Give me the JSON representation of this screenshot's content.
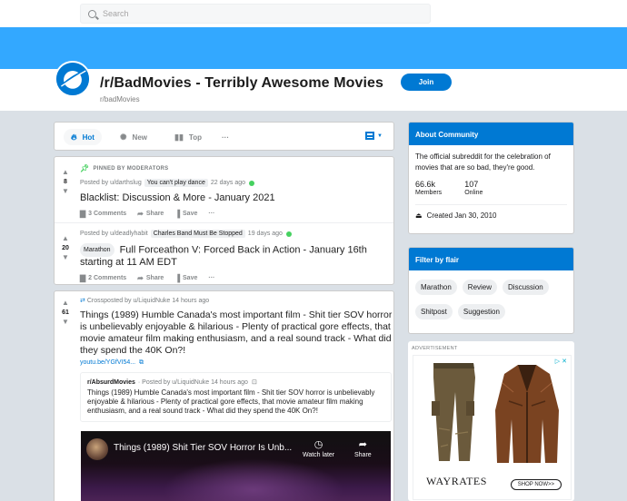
{
  "search": {
    "placeholder": "Search"
  },
  "colors": {
    "banner": "#33a8ff",
    "brand": "#0079d3",
    "mod_pin": "#46d160"
  },
  "subreddit": {
    "title": "/r/BadMovies - Terribly Awesome Movies",
    "name": "r/badMovies",
    "join_label": "Join",
    "logo_icon": "planet-icon"
  },
  "sort": {
    "items": [
      {
        "label": "Hot",
        "icon": "flame-icon"
      },
      {
        "label": "New",
        "icon": "sparkle-icon"
      },
      {
        "label": "Top",
        "icon": "bar-chart-icon"
      }
    ],
    "more_label": "···"
  },
  "pinned": {
    "label": "PINNED BY MODERATORS",
    "posts": [
      {
        "score": "8",
        "posted_by": "Posted by u/darthslug",
        "flair": "You can't play dance",
        "age": "22 days ago",
        "title": "Blacklist: Discussion & More - January 2021",
        "comments": "3 Comments",
        "share": "Share",
        "save": "Save",
        "more": "···"
      },
      {
        "score": "20",
        "posted_by": "Posted by u/deadlyhabit",
        "flair": "Charles Band Must Be Stopped",
        "age": "19 days ago",
        "tag": "Marathon",
        "title": "Full Forceathon V: Forced Back in Action - January 16th starting at 11 AM EDT",
        "comments": "2 Comments",
        "share": "Share",
        "save": "Save",
        "more": "···"
      }
    ]
  },
  "crosspost": {
    "score": "61",
    "meta": "Crossposted by u/LiquidNuke 14 hours ago",
    "title": "Things (1989) Humble Canada's most important film - Shit tier SOV horror is unbelievably enjoyable & hilarious - Plenty of practical gore effects, that movie amateur film making enthusiasm, and a real sound track - What did they spend the 40K On?!",
    "link": "youtu.be/YGfVI54...",
    "embed": {
      "sub": "r/AbsurdMovies",
      "posted_by": "· Posted by u/LiquidNuke 14 hours ago",
      "title": "Things (1989) Humble Canada's most important film - Shit tier SOV horror is unbelievably enjoyable & hilarious - Plenty of practical gore effects, that movie amateur film making enthusiasm, and a real sound track - What did they spend the 40K On?!"
    },
    "video": {
      "title": "Things (1989) Shit Tier SOV Horror Is Unb...",
      "watch_later": "Watch later",
      "share": "Share"
    }
  },
  "about": {
    "heading": "About Community",
    "description": "The official subreddit for the celebration of movies that are so bad, they're good.",
    "members_count": "66.6k",
    "members_label": "Members",
    "online_count": "107",
    "online_label": "Online",
    "created": "Created Jan 30, 2010"
  },
  "flair_filter": {
    "heading": "Filter by flair",
    "chips": [
      "Marathon",
      "Review",
      "Discussion",
      "Shitpost",
      "Suggestion"
    ]
  },
  "ad": {
    "label": "ADVERTISEMENT",
    "brand": "WAYRATES",
    "cta": "SHOP NOW>>",
    "choice": "▷ ✕"
  }
}
